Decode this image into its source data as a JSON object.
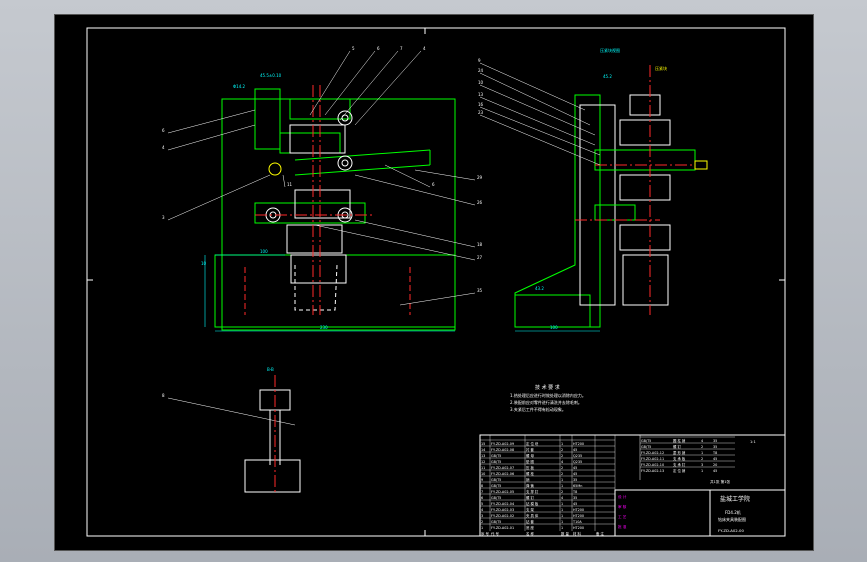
{
  "colors": {
    "background": "#000000",
    "frame": "#ffffff",
    "outline": "#00ff00",
    "centerline": "#ff2a2a",
    "dimension": "#00ffff",
    "hidden": "#ffffff",
    "highlight": "#ffff00",
    "title_block_accent": "#ff00ff"
  },
  "drawing": {
    "section_label": "B-B",
    "view_note": "压紧块视图",
    "tech_req_title": "技 术 要 求",
    "tech_req_lines": [
      "1.热处理后应进行时效处理以消除内应力。",
      "2.装配前应对零件进行清洗并去除毛刺。",
      "3.夹紧后工件不得有松动现象。"
    ],
    "dimensions": {
      "d1": "Φ14.2",
      "d2": "45.5±0.10",
      "d3": "100",
      "d4": "10",
      "d5": "230",
      "d6": "100",
      "d7": "43.2",
      "d8": "Φ4",
      "d9": "45.2",
      "d10": "压紧块",
      "d11": "6"
    },
    "balloons_left": [
      "5",
      "6",
      "7",
      "4",
      "6",
      "4",
      "3",
      "11",
      "6",
      "29",
      "26",
      "18",
      "27",
      "35",
      "8"
    ],
    "balloons_right": [
      "9",
      "24",
      "10",
      "13",
      "16",
      "23"
    ]
  },
  "title_block": {
    "company": "盐城工学院",
    "product": "FD4.2机",
    "subtitle": "钻床夹具装配图",
    "drawing_no": "FY-ZD-A02-00",
    "scale": "1:1",
    "sheet_info": "共1张 第1张",
    "bom_rows": [
      [
        "15",
        "FY-ZD-A02-09",
        "定 位 块",
        "1",
        "HT200",
        ""
      ],
      [
        "14",
        "FY-ZD-A02-08",
        "衬 套",
        "2",
        "45",
        ""
      ],
      [
        "13",
        "GB/T5",
        "螺 母",
        "2",
        "Q235",
        ""
      ],
      [
        "12",
        "GB/T5",
        "垫 圈",
        "4",
        "Q235",
        ""
      ],
      [
        "11",
        "FY-ZD-A02-07",
        "压 板",
        "2",
        "45",
        ""
      ],
      [
        "10",
        "FY-ZD-A02-06",
        "螺 栓",
        "2",
        "45",
        ""
      ],
      [
        "9",
        "GB/T5",
        "销",
        "1",
        "35",
        ""
      ],
      [
        "8",
        "GB/T5",
        "弹 簧",
        "1",
        "65Mn",
        ""
      ],
      [
        "7",
        "FY-ZD-A02-05",
        "支 撑 钉",
        "2",
        "T8",
        ""
      ],
      [
        "6",
        "GB/T5",
        "螺 钉",
        "4",
        "35",
        ""
      ],
      [
        "5",
        "FY-ZD-A02-04",
        "钻 模 板",
        "1",
        "45",
        ""
      ],
      [
        "4",
        "FY-ZD-A02-03",
        "支 架",
        "1",
        "HT200",
        ""
      ],
      [
        "3",
        "FY-ZD-A02-02",
        "夹 具 体",
        "1",
        "HT200",
        ""
      ],
      [
        "2",
        "GB/T5",
        "钻 套",
        "1",
        "T10A",
        ""
      ],
      [
        "1",
        "FY-ZD-A02-01",
        "底 座",
        "1",
        "HT200",
        ""
      ]
    ],
    "bom_right_rows": [
      [
        "GB/T5",
        "圆 柱 销",
        "4",
        "35"
      ],
      [
        "GB/T5",
        "螺 钉",
        "2",
        "35"
      ],
      [
        "FY-ZD-A02-12",
        "菱 形 销",
        "1",
        "T8"
      ],
      [
        "FY-ZD-A02-11",
        "支 承 板",
        "2",
        "45"
      ],
      [
        "FY-ZD-A02-10",
        "支 承 钉",
        "3",
        "20"
      ],
      [
        "FY-ZD-A02-13",
        "定 位 销",
        "1",
        "45"
      ]
    ],
    "header": [
      "序 号",
      "代 号",
      "名 称",
      "数 量",
      "材 料",
      "备 注"
    ],
    "sign_labels": [
      "设 计",
      "审 核",
      "工 艺",
      "批 准"
    ]
  }
}
